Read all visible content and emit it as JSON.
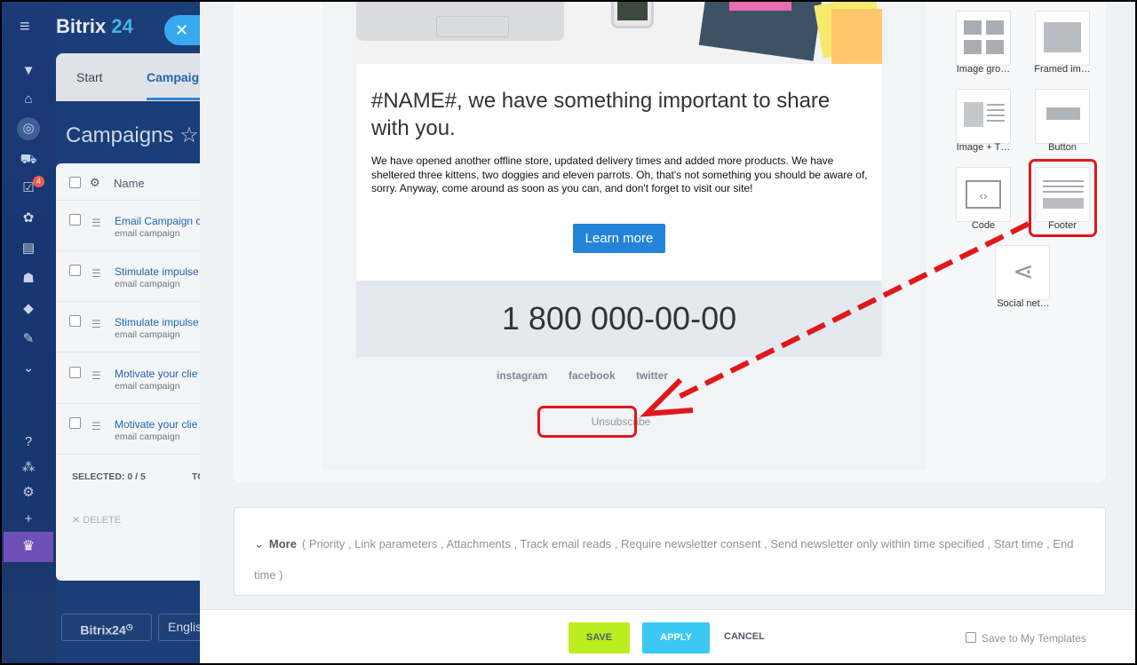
{
  "app": {
    "logo_main": "Bitrix",
    "logo_accent": "24",
    "close_icon": "✕"
  },
  "bg": {
    "tab_start": "Start",
    "tab_campaigns": "Campaig",
    "title": "Campaigns",
    "star": "☆",
    "list_header": "Name",
    "rows": [
      {
        "name": "Email Campaign c",
        "type": "email campaign"
      },
      {
        "name": "Stimulate impulse",
        "type": "email campaign"
      },
      {
        "name": "Stimulate impulse",
        "type": "email campaign"
      },
      {
        "name": "Motivate your clie",
        "type": "email campaign"
      },
      {
        "name": "Motivate your clie",
        "type": "email campaign"
      }
    ],
    "selected": "SELECTED: 0 / 5",
    "selected_cut": "TO",
    "delete": "DELETE",
    "badge": "4",
    "footer_btn1": "Bitrix24",
    "footer_btn2": "Englis"
  },
  "email": {
    "title": "#NAME#, we have something important to share with you.",
    "body": "We have opened another offline store, updated delivery times and added more products. We have sheltered three kittens, two doggies and eleven parrots. Oh, that's not something you should be aware of, sorry. Anyway, come around as soon as you can, and don't forget to visit our site!",
    "button": "Learn more",
    "phone": "1 800 000-00-00",
    "social": [
      "instagram",
      "facebook",
      "twitter"
    ],
    "unsubscribe": "Unsubscribe"
  },
  "palette": [
    {
      "label": "Image gro…",
      "icon": "image-group-icon"
    },
    {
      "label": "Framed im…",
      "icon": "framed-image-icon"
    },
    {
      "label": "Image + T…",
      "icon": "image-text-icon"
    },
    {
      "label": "Button",
      "icon": "button-block-icon"
    },
    {
      "label": "Code",
      "icon": "code-icon"
    },
    {
      "label": "Footer",
      "icon": "footer-icon"
    },
    {
      "label": "Social net…",
      "icon": "share-icon"
    }
  ],
  "more": {
    "label": "More",
    "items": "( Priority ,  Link parameters ,  Attachments ,  Track email reads ,  Require newsletter consent ,  Send newsletter only within time specified ,  Start time ,  End time  )"
  },
  "footer": {
    "save": "SAVE",
    "apply": "APPLY",
    "cancel": "CANCEL",
    "save_template": "Save to My Templates"
  },
  "colors": {
    "accent": "#2067b0",
    "save": "#bbed21",
    "apply": "#3bc8f5",
    "highlight": "#e0181b"
  }
}
